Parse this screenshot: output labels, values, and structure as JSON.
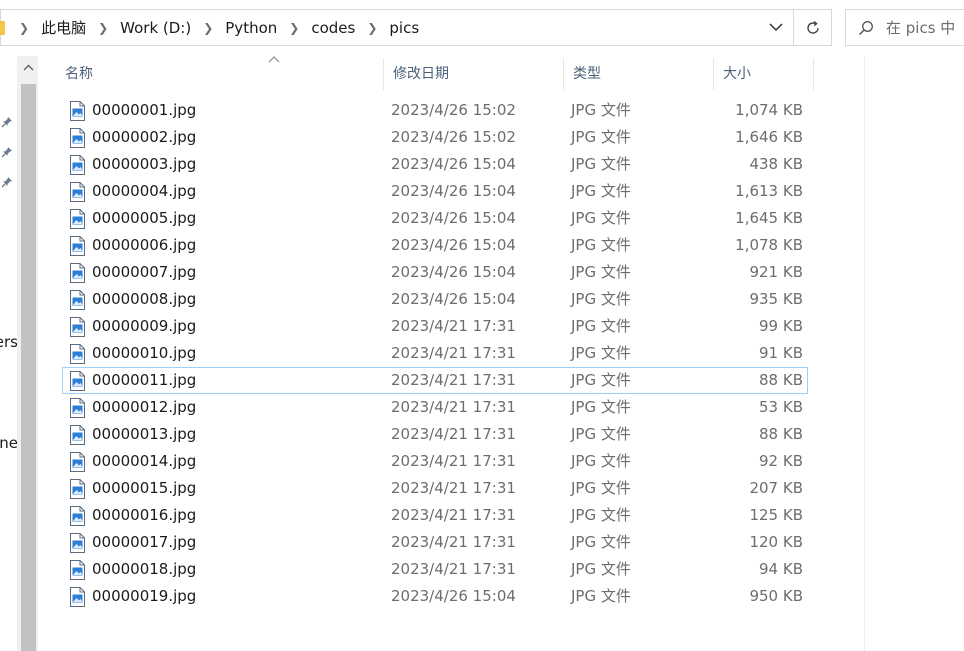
{
  "breadcrumb": {
    "items": [
      "此电脑",
      "Work (D:)",
      "Python",
      "codes",
      "pics"
    ]
  },
  "search": {
    "placeholder": "在 pics 中"
  },
  "nav": {
    "partial_labels": [
      "ers",
      "ne"
    ]
  },
  "columns": {
    "name": "名称",
    "date": "修改日期",
    "type": "类型",
    "size": "大小"
  },
  "files": [
    {
      "name": "00000001.jpg",
      "date": "2023/4/26 15:02",
      "type": "JPG 文件",
      "size": "1,074 KB"
    },
    {
      "name": "00000002.jpg",
      "date": "2023/4/26 15:02",
      "type": "JPG 文件",
      "size": "1,646 KB"
    },
    {
      "name": "00000003.jpg",
      "date": "2023/4/26 15:04",
      "type": "JPG 文件",
      "size": "438 KB"
    },
    {
      "name": "00000004.jpg",
      "date": "2023/4/26 15:04",
      "type": "JPG 文件",
      "size": "1,613 KB"
    },
    {
      "name": "00000005.jpg",
      "date": "2023/4/26 15:04",
      "type": "JPG 文件",
      "size": "1,645 KB"
    },
    {
      "name": "00000006.jpg",
      "date": "2023/4/26 15:04",
      "type": "JPG 文件",
      "size": "1,078 KB"
    },
    {
      "name": "00000007.jpg",
      "date": "2023/4/26 15:04",
      "type": "JPG 文件",
      "size": "921 KB"
    },
    {
      "name": "00000008.jpg",
      "date": "2023/4/26 15:04",
      "type": "JPG 文件",
      "size": "935 KB"
    },
    {
      "name": "00000009.jpg",
      "date": "2023/4/21 17:31",
      "type": "JPG 文件",
      "size": "99 KB"
    },
    {
      "name": "00000010.jpg",
      "date": "2023/4/21 17:31",
      "type": "JPG 文件",
      "size": "91 KB"
    },
    {
      "name": "00000011.jpg",
      "date": "2023/4/21 17:31",
      "type": "JPG 文件",
      "size": "88 KB",
      "selected": true
    },
    {
      "name": "00000012.jpg",
      "date": "2023/4/21 17:31",
      "type": "JPG 文件",
      "size": "53 KB"
    },
    {
      "name": "00000013.jpg",
      "date": "2023/4/21 17:31",
      "type": "JPG 文件",
      "size": "88 KB"
    },
    {
      "name": "00000014.jpg",
      "date": "2023/4/21 17:31",
      "type": "JPG 文件",
      "size": "92 KB"
    },
    {
      "name": "00000015.jpg",
      "date": "2023/4/21 17:31",
      "type": "JPG 文件",
      "size": "207 KB"
    },
    {
      "name": "00000016.jpg",
      "date": "2023/4/21 17:31",
      "type": "JPG 文件",
      "size": "125 KB"
    },
    {
      "name": "00000017.jpg",
      "date": "2023/4/21 17:31",
      "type": "JPG 文件",
      "size": "120 KB"
    },
    {
      "name": "00000018.jpg",
      "date": "2023/4/21 17:31",
      "type": "JPG 文件",
      "size": "94 KB"
    },
    {
      "name": "00000019.jpg",
      "date": "2023/4/26 15:04",
      "type": "JPG 文件",
      "size": "950 KB"
    }
  ]
}
